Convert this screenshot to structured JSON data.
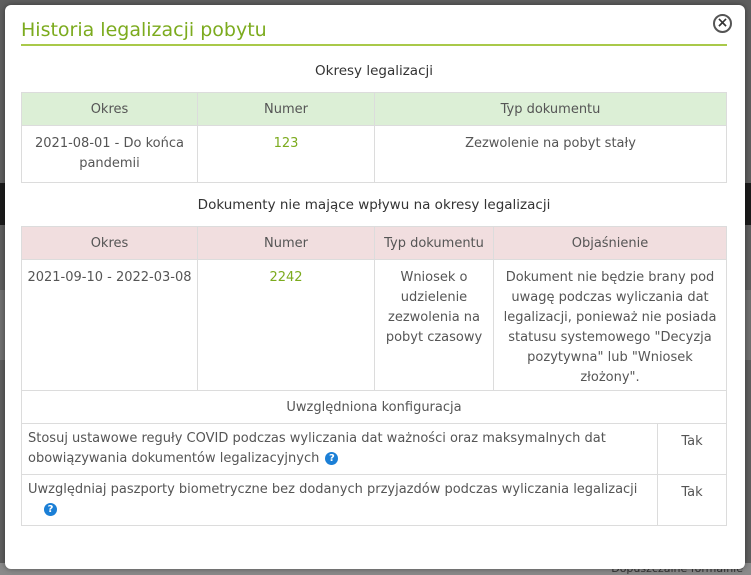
{
  "modal": {
    "title": "Historia legalizacji pobytu",
    "close_symbol": "×"
  },
  "periods": {
    "title": "Okresy legalizacji",
    "headers": [
      "Okres",
      "Numer",
      "Typ dokumentu"
    ],
    "rows": [
      {
        "okres": "2021-08-01 - Do końca pandemii",
        "numer": "123",
        "typ": "Zezwolenie na pobyt stały"
      }
    ]
  },
  "non_affecting": {
    "title": "Dokumenty nie mające wpływu na okresy legalizacji",
    "headers": [
      "Okres",
      "Numer",
      "Typ dokumentu",
      "Objaśnienie"
    ],
    "rows": [
      {
        "okres": "2021-09-10 - 2022-03-08",
        "numer": "2242",
        "typ": "Wniosek o udzielenie zezwolenia na pobyt czasowy",
        "objasnienie": "Dokument nie będzie brany pod uwagę podczas wyliczania dat legalizacji, ponieważ nie posiada statusu systemowego \"Decyzja pozytywna\" lub \"Wniosek złożony\"."
      }
    ]
  },
  "config": {
    "title": "Uwzględniona konfiguracja",
    "rows": [
      {
        "label": "Stosuj ustawowe reguły COVID podczas wyliczania dat ważności oraz maksymalnych dat obowiązywania dokumentów legalizacyjnych",
        "value": "Tak"
      },
      {
        "label": "Uwzględniaj paszporty biometryczne bez dodanych przyjazdów podczas wyliczania legalizacji",
        "value": "Tak"
      }
    ]
  },
  "background": {
    "footer_text": "Dopuszczalne formalnie"
  },
  "colors": {
    "accent": "#7cab1e",
    "green_header": "#dcefd6",
    "red_header": "#f1dedf",
    "help_icon": "#1b7fd6"
  },
  "icons": {
    "close": "close-icon",
    "help": "help-icon"
  }
}
